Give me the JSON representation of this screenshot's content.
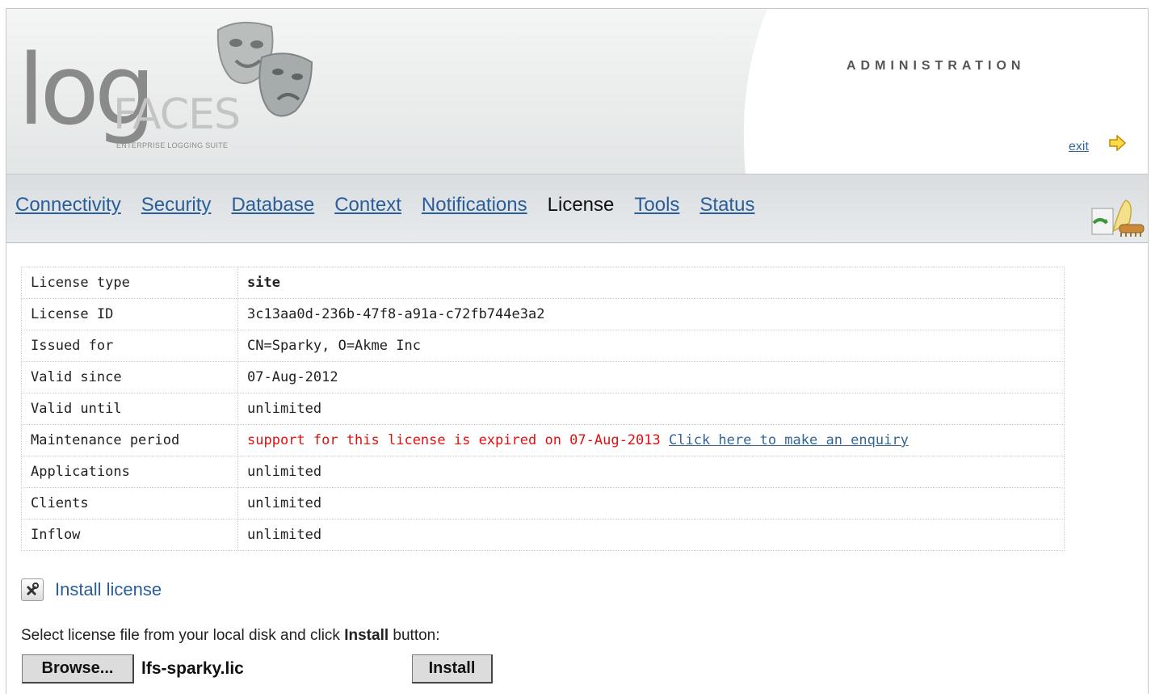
{
  "header": {
    "logo_main": "log",
    "logo_accent": "FACES",
    "logo_tagline": "ENTERPRISE LOGGING SUITE",
    "section_title": "ADMINISTRATION",
    "exit_label": "exit"
  },
  "nav": {
    "items": [
      {
        "label": "Connectivity",
        "active": false
      },
      {
        "label": "Security",
        "active": false
      },
      {
        "label": "Database",
        "active": false
      },
      {
        "label": "Context",
        "active": false
      },
      {
        "label": "Notifications",
        "active": false
      },
      {
        "label": "License",
        "active": true
      },
      {
        "label": "Tools",
        "active": false
      },
      {
        "label": "Status",
        "active": false
      }
    ]
  },
  "license": {
    "rows": [
      {
        "key": "License type",
        "value": "site"
      },
      {
        "key": "License ID",
        "value": "3c13aa0d-236b-47f8-a91a-c72fb744e3a2"
      },
      {
        "key": "Issued for",
        "value": "CN=Sparky, O=Akme Inc"
      },
      {
        "key": "Valid since",
        "value": "07-Aug-2012"
      },
      {
        "key": "Valid until",
        "value": "unlimited"
      },
      {
        "key": "Maintenance period",
        "value": "support for this license is expired on 07-Aug-2013",
        "link": "Click here to make an enquiry"
      },
      {
        "key": "Applications",
        "value": "unlimited"
      },
      {
        "key": "Clients",
        "value": "unlimited"
      },
      {
        "key": "Inflow",
        "value": "unlimited"
      }
    ]
  },
  "install": {
    "title": "Install license",
    "instruction_pre": "Select license file from your local disk and click ",
    "instruction_bold": "Install",
    "instruction_post": " button:",
    "browse_label": "Browse...",
    "file_name": "lfs-sparky.lic",
    "install_label": "Install"
  },
  "colors": {
    "link": "#2a5e9a",
    "warning": "#e01010",
    "nav_bg": "#dfe2e5"
  }
}
